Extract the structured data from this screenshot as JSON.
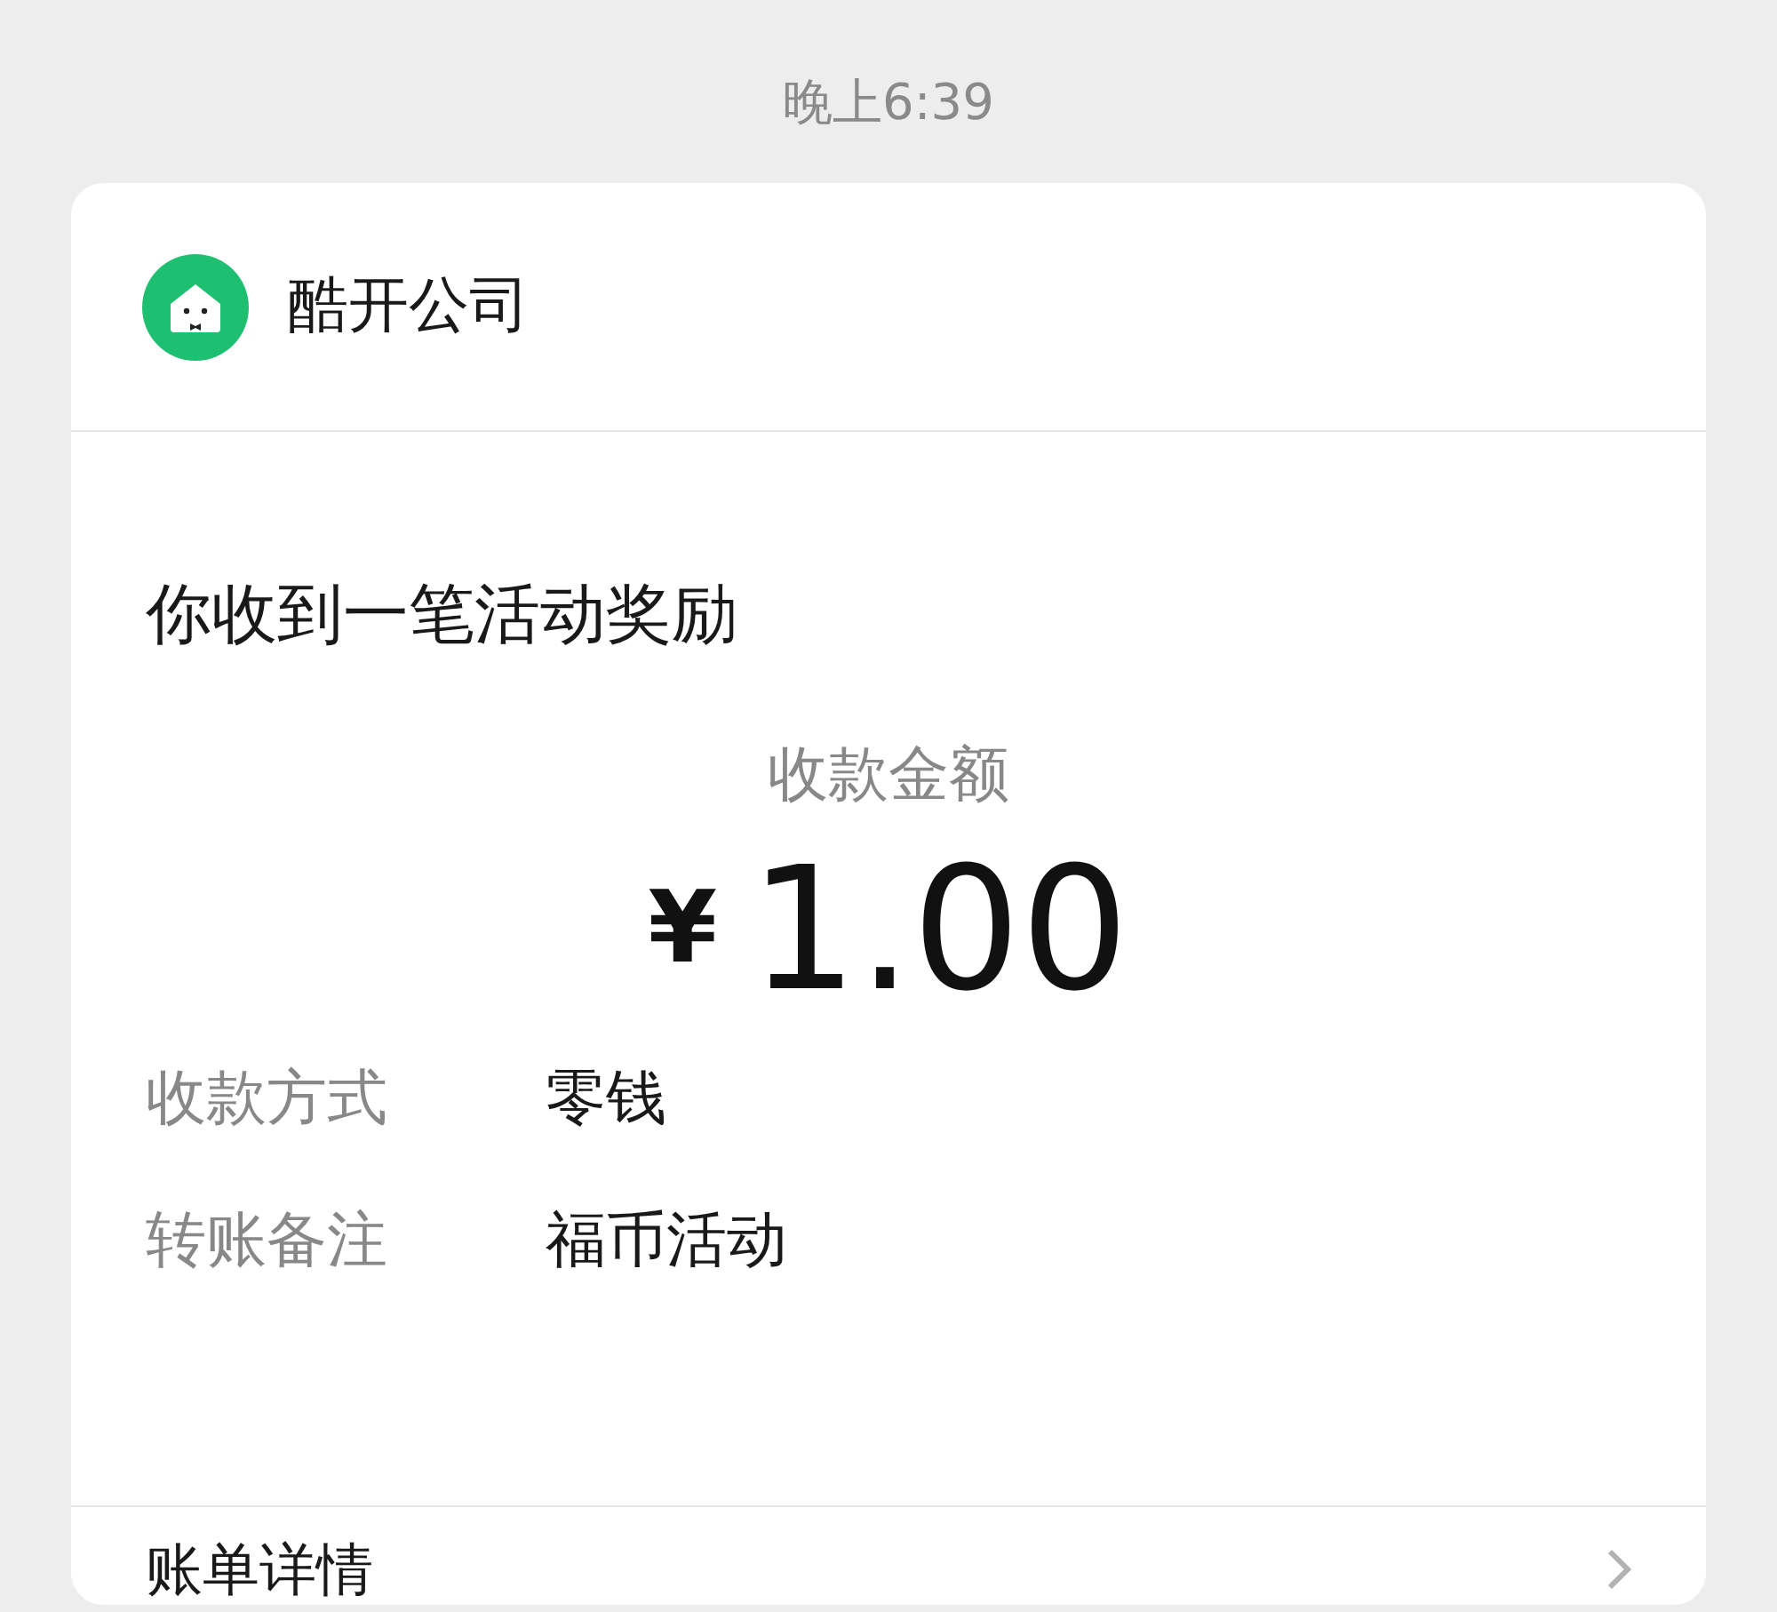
{
  "timestamp": "晚上6:39",
  "card": {
    "sender": "酷开公司",
    "title": "你收到一笔活动奖励",
    "amount_label": "收款金额",
    "amount_symbol": "¥",
    "amount": "1.00",
    "details": [
      {
        "label": "收款方式",
        "value": "零钱"
      },
      {
        "label": "转账备注",
        "value": "福币活动"
      }
    ],
    "footer_link": "账单详情"
  }
}
